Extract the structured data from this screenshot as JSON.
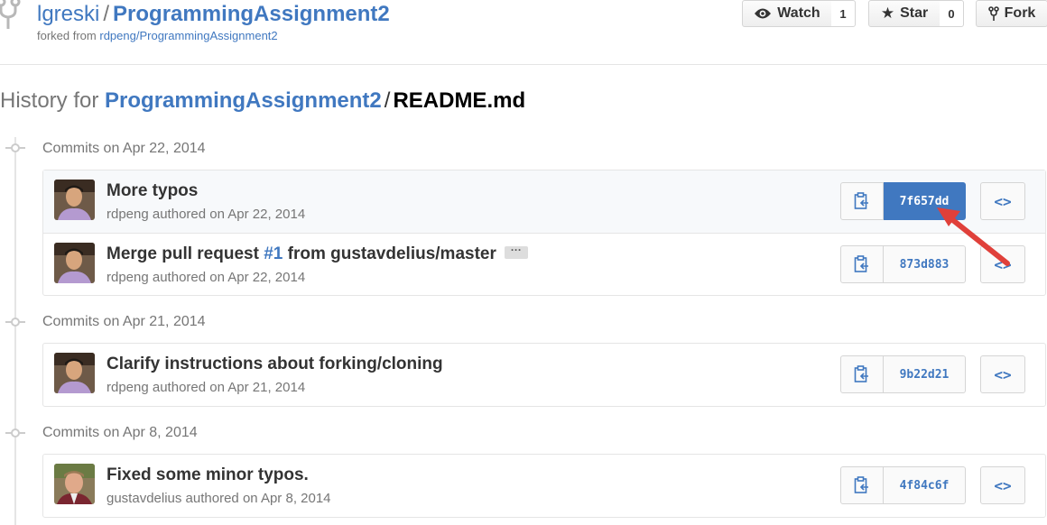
{
  "repo": {
    "owner": "lgreski",
    "separator": "/",
    "name": "ProgrammingAssignment2",
    "forked_prefix": "forked from",
    "forked_source": "rdpeng/ProgrammingAssignment2"
  },
  "actions": {
    "watch": {
      "label": "Watch",
      "count": "1",
      "icon": "eye-icon"
    },
    "star": {
      "label": "Star",
      "count": "0",
      "icon": "star-icon"
    },
    "fork": {
      "label": "Fork",
      "icon": "fork-icon"
    }
  },
  "history": {
    "prefix": "History for",
    "repo": "ProgrammingAssignment2",
    "separator": "/",
    "file": "README.md"
  },
  "groups": [
    {
      "date": "Commits on Apr 22, 2014",
      "commits": [
        {
          "message": "More typos",
          "author_line": "rdpeng authored on Apr 22, 2014",
          "sha": "7f657dd",
          "selected": true
        },
        {
          "message_before": "Merge pull request",
          "pr": "#1",
          "message_after": "from gustavdelius/master",
          "ellipsis": "···",
          "author_line": "rdpeng authored on Apr 22, 2014",
          "sha": "873d883"
        }
      ]
    },
    {
      "date": "Commits on Apr 21, 2014",
      "commits": [
        {
          "message": "Clarify instructions about forking/cloning",
          "author_line": "rdpeng authored on Apr 21, 2014",
          "sha": "9b22d21"
        }
      ]
    },
    {
      "date": "Commits on Apr 8, 2014",
      "commits": [
        {
          "message": "Fixed some minor typos.",
          "author_line": "gustavdelius authored on Apr 8, 2014",
          "sha": "4f84c6f"
        }
      ]
    }
  ],
  "browse_label": "<>",
  "colors": {
    "link": "#4078c0",
    "active_sha_bg": "#4078c0",
    "arrow": "#e0403a"
  }
}
